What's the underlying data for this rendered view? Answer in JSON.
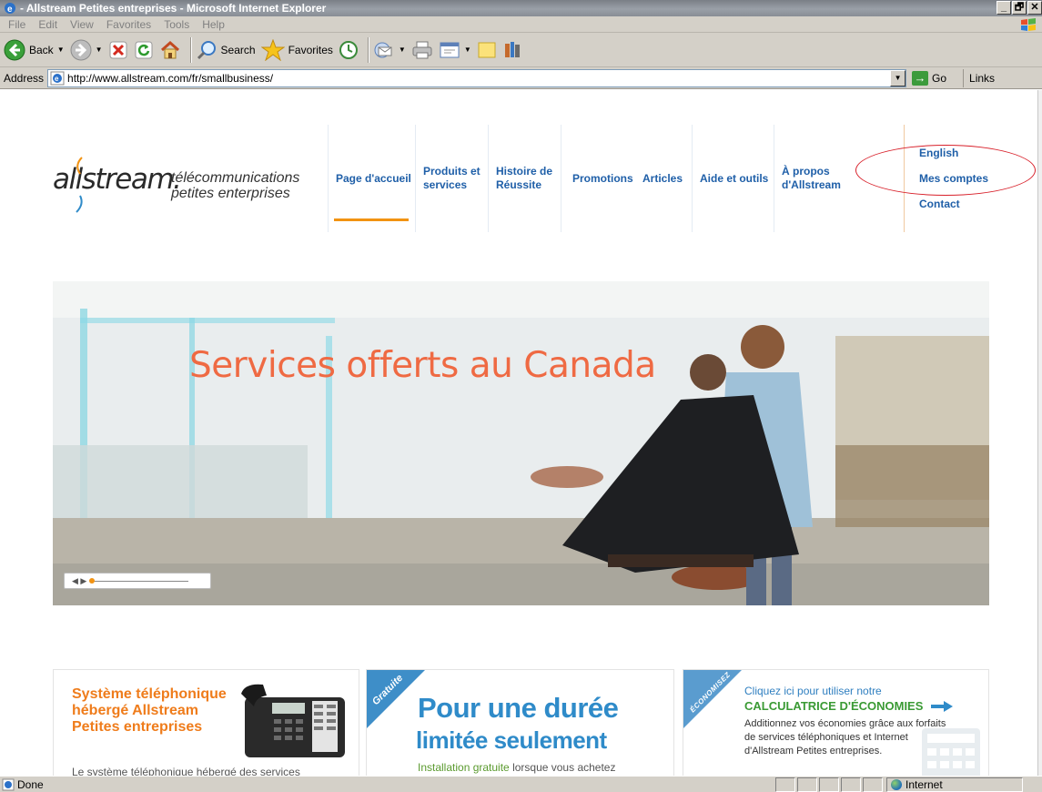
{
  "window": {
    "title": "- Allstream Petites entreprises - Microsoft Internet Explorer",
    "controls": [
      "_",
      "🗗",
      "✕"
    ]
  },
  "menu": [
    "File",
    "Edit",
    "View",
    "Favorites",
    "Tools",
    "Help"
  ],
  "toolbar": {
    "back_label": "Back",
    "search_label": "Search",
    "favorites_label": "Favorites"
  },
  "address": {
    "label": "Address",
    "url": "http://www.allstream.com/fr/smallbusiness/",
    "go_label": "Go",
    "links_label": "Links"
  },
  "header": {
    "logo_text": "allstream.",
    "tagline_line1": "télécommunications",
    "tagline_line2": "petites enterprises",
    "nav": [
      {
        "l1": "Page d'accueil",
        "l2": ""
      },
      {
        "l1": "Produits et",
        "l2": "services"
      },
      {
        "l1": "Histoire de",
        "l2": "Réussite"
      },
      {
        "l1": "Promotions",
        "l2": ""
      },
      {
        "l1": "Articles",
        "l2": ""
      },
      {
        "l1": "Aide et outils",
        "l2": ""
      },
      {
        "l1": "À propos",
        "l2": "d'Allstream"
      }
    ],
    "utility": [
      "English",
      "Mes comptes",
      "Contact"
    ]
  },
  "hero": {
    "caption": "Services offerts au Canada",
    "controls": "◀ ▶"
  },
  "cards": {
    "phone": {
      "title_l1": "Système téléphonique",
      "title_l2": "hébergé Allstream",
      "title_l3": "Petites entreprises",
      "body": "Le système téléphonique hébergé des services"
    },
    "limited": {
      "banner": "Gratuite",
      "title_l1": "Pour une durée",
      "title_l2": "limitée seulement",
      "body_highlight": "Installation gratuite",
      "body_rest": " lorsque vous achetez"
    },
    "savings": {
      "banner": "ÉCONOMISEZ",
      "line1": "Cliquez ici pour utiliser notre",
      "line2": "CALCULATRICE D'ÉCONOMIES",
      "body_l1": "Additionnez vos économies grâce aux forfaits",
      "body_l2": "de services téléphoniques et Internet",
      "body_l3": "d'Allstream Petites entreprises."
    }
  },
  "status": {
    "text": "Done",
    "zone": "Internet"
  },
  "colors": {
    "nav_blue": "#1f5fa8",
    "accent_orange": "#f29312",
    "hero_text": "#ef6a43",
    "annotation_red": "#d8202a"
  }
}
